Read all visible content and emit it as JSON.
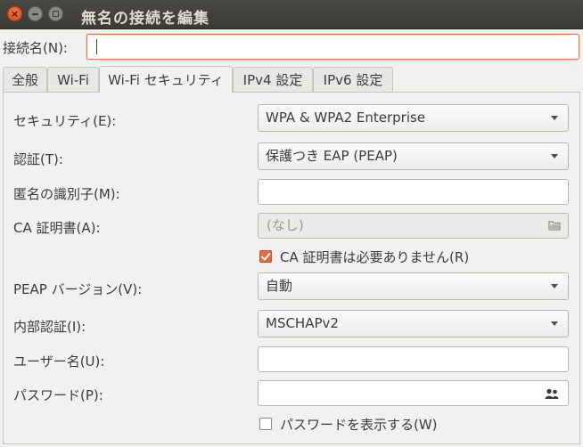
{
  "window": {
    "title": "無名の接続を編集"
  },
  "connection_name": {
    "label": "接続名(N):",
    "value": ""
  },
  "tabs": [
    {
      "label": "全般"
    },
    {
      "label": "Wi-Fi"
    },
    {
      "label": "Wi-Fi セキュリティ",
      "active": true
    },
    {
      "label": "IPv4 設定"
    },
    {
      "label": "IPv6 設定"
    }
  ],
  "form": {
    "security": {
      "label": "セキュリティ(E):",
      "value": "WPA & WPA2 Enterprise"
    },
    "auth": {
      "label": "認証(T):",
      "value": "保護つき EAP (PEAP)"
    },
    "anon_identity": {
      "label": "匿名の識別子(M):",
      "value": ""
    },
    "ca_cert": {
      "label": "CA 証明書(A):",
      "value": "(なし)",
      "icon": "file-icon"
    },
    "ca_not_required": {
      "label": "CA 証明書は必要ありません(R)",
      "checked": true
    },
    "peap_version": {
      "label": "PEAP バージョン(V):",
      "value": "自動"
    },
    "inner_auth": {
      "label": "内部認証(I):",
      "value": "MSCHAPv2"
    },
    "username": {
      "label": "ユーザー名(U):",
      "value": ""
    },
    "password": {
      "label": "パスワード(P):",
      "value": "",
      "icon": "users-icon"
    },
    "show_password": {
      "label": "パスワードを表示する(W)",
      "checked": false
    }
  },
  "colors": {
    "accent": "#e66a3a",
    "titlebar": "#3c3b37"
  }
}
